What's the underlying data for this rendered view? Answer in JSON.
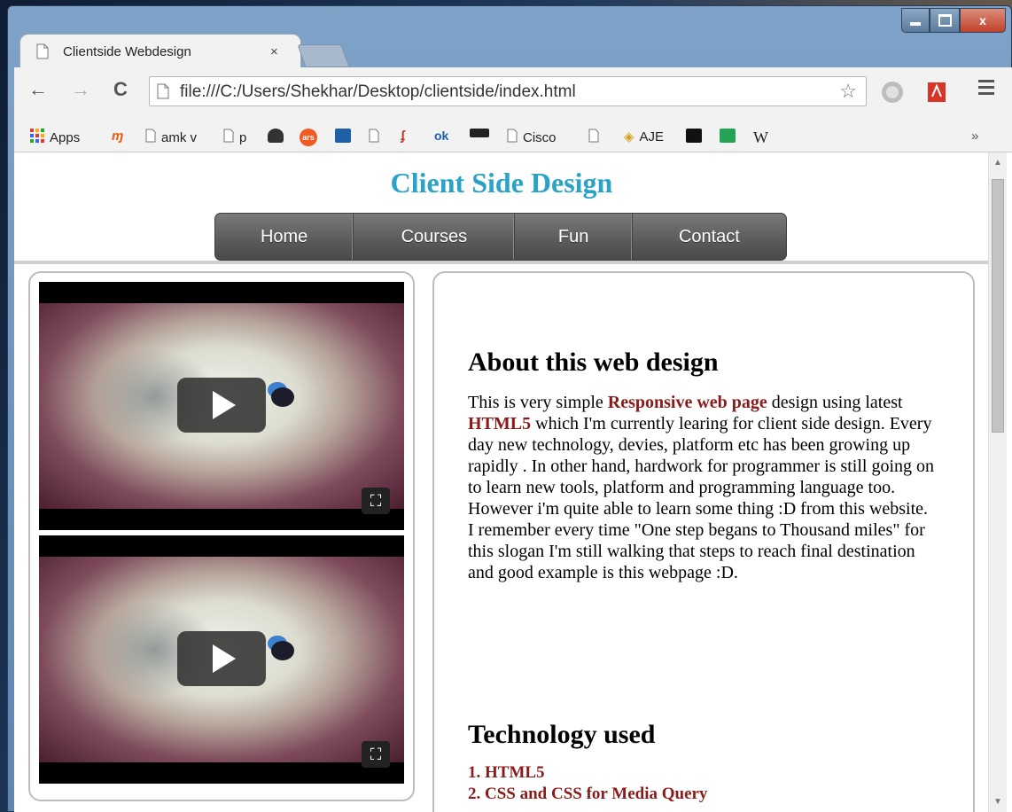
{
  "window": {
    "minimize_symbol": "",
    "close_symbol": "x"
  },
  "tab": {
    "title": "Clientside Webdesign",
    "close": "×"
  },
  "toolbar": {
    "back": "←",
    "forward": "→",
    "reload": "C",
    "url": "file:///C:/Users/Shekhar/Desktop/clientside/index.html",
    "star": "☆"
  },
  "bookmarks": {
    "items": [
      "Apps",
      "amk v",
      "p",
      "ars",
      "Cisco",
      "AJE",
      "W"
    ],
    "overflow": "»"
  },
  "colors": {
    "title": "#2aa3c6",
    "highlight": "#8b1a1a"
  },
  "page": {
    "title": "Client Side Design",
    "menu": [
      "Home",
      "Courses",
      "Fun",
      "Contact"
    ],
    "about_heading": "About this web design",
    "para": {
      "p1": "This is very simple ",
      "h1": "Responsive web page",
      "p2": " design using latest ",
      "h2": "HTML5",
      "p3": " which I'm currently learing for client side design. Every day new technology, devies, platform etc has been growing up rapidly . In other hand, hardwork for programmer is still going on to learn new tools, platform and programming language too. However i'm quite able to learn some thing :D from this website. I remember every time \"One step begans to Thousand miles\" for this slogan I'm still walking that steps to reach final destination and good example is this webpage :D."
    },
    "tech_heading": "Technology used",
    "tech_list": [
      "1. HTML5",
      "2. CSS and CSS for Media Query"
    ]
  }
}
